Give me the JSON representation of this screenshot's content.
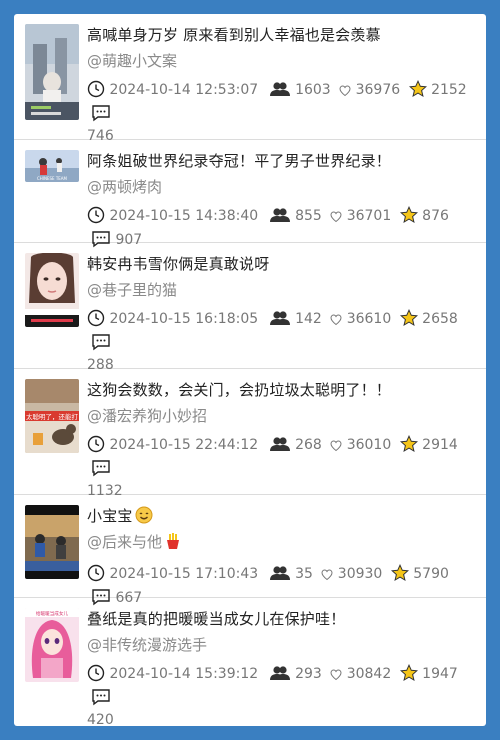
{
  "items": [
    {
      "title": "高喊单身万岁 原来看到别人幸福也是会羡慕",
      "author": "@萌趣小文案",
      "time": "2024-10-14 12:53:07",
      "views": "1603",
      "likes": "36976",
      "favorites": "2152",
      "comments": "746"
    },
    {
      "title": "阿条姐破世界纪录夺冠！平了男子世界纪录！",
      "author": "@两顿烤肉",
      "time": "2024-10-15 14:38:40",
      "views": "855",
      "likes": "36701",
      "favorites": "876",
      "comments": "907"
    },
    {
      "title": "韩安冉韦雪你俩是真敢说呀",
      "author": "@巷子里的猫",
      "time": "2024-10-15 16:18:05",
      "views": "142",
      "likes": "36610",
      "favorites": "2658",
      "comments": "288"
    },
    {
      "title": "这狗会数数，会关门，会扔垃圾太聪明了！！",
      "author": "@潘宏养狗小妙招",
      "time": "2024-10-15 22:44:12",
      "views": "268",
      "likes": "36010",
      "favorites": "2914",
      "comments": "1132"
    },
    {
      "title": "小宝宝",
      "author": "@后来与他",
      "time": "2024-10-15 17:10:43",
      "views": "35",
      "likes": "30930",
      "favorites": "5790",
      "comments": "667",
      "title_emoji": "smile-emoji",
      "author_emoji": "fries-emoji"
    },
    {
      "title": "叠纸是真的把暖暖当成女儿在保护哇！",
      "author": "@非传统漫游选手",
      "time": "2024-10-14 15:39:12",
      "views": "293",
      "likes": "30842",
      "favorites": "1947",
      "comments": "420"
    }
  ],
  "thumbnails": [
    {
      "icon": "thumbnail-monument"
    },
    {
      "icon": "thumbnail-sports",
      "caption": "CHINESE TEAM"
    },
    {
      "icon": "thumbnail-face"
    },
    {
      "icon": "thumbnail-dog",
      "caption": "太聪明了，还能打"
    },
    {
      "icon": "thumbnail-kids"
    },
    {
      "icon": "thumbnail-anime",
      "caption": "给暖暖当成女儿"
    }
  ],
  "colors": {
    "background": "#3a7fc1",
    "panel": "#ffffff",
    "star": "#f5c518",
    "divider": "#dcdcdc"
  }
}
